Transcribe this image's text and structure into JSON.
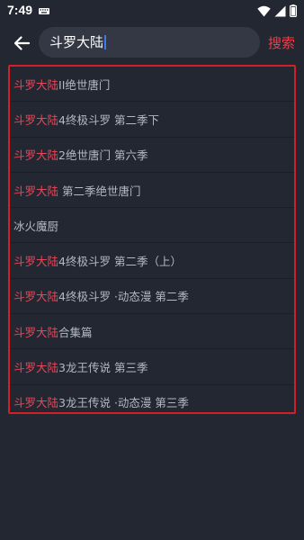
{
  "status_bar": {
    "time": "7:49"
  },
  "search": {
    "query": "斗罗大陆",
    "button_label": "搜索"
  },
  "suggestions": [
    {
      "highlight": "斗罗大陆",
      "rest": "II绝世唐门"
    },
    {
      "highlight": "斗罗大陆",
      "rest": "4终极斗罗 第二季下"
    },
    {
      "highlight": "斗罗大陆",
      "rest": "2绝世唐门 第六季"
    },
    {
      "highlight": "斗罗大陆",
      "rest": " 第二季绝世唐门"
    },
    {
      "highlight": "",
      "rest": "冰火魔厨"
    },
    {
      "highlight": "斗罗大陆",
      "rest": "4终极斗罗 第二季（上）"
    },
    {
      "highlight": "斗罗大陆",
      "rest": "4终极斗罗 ·动态漫 第二季"
    },
    {
      "highlight": "斗罗大陆",
      "rest": "合集篇"
    },
    {
      "highlight": "斗罗大陆",
      "rest": "3龙王传说 第三季"
    },
    {
      "highlight": "斗罗大陆",
      "rest": "3龙王传说 ·动态漫 第三季"
    }
  ],
  "icons": {
    "notification": "keyboard-notification-icon",
    "wifi": "wifi-icon",
    "signal": "cellular-signal-icon",
    "battery": "battery-icon",
    "back": "back-arrow-icon"
  },
  "colors": {
    "background": "#232731",
    "search_field": "#333844",
    "accent": "#e8404c",
    "highlight_text": "#e8475a",
    "selection_border": "#d41f26",
    "caret": "#3d7be8"
  }
}
